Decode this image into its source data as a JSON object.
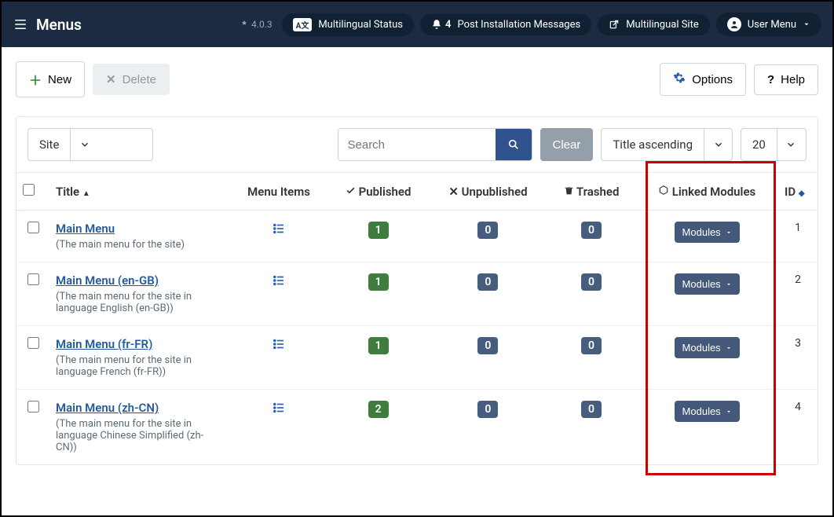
{
  "topnav": {
    "page_title": "Menus",
    "version": "4.0.3",
    "multilingual_status_label": "Multilingual Status",
    "post_install_count": "4",
    "post_install_label": "Post Installation Messages",
    "multilingual_site_label": "Multilingual Site",
    "user_menu_label": "User Menu"
  },
  "toolbar": {
    "new_label": "New",
    "delete_label": "Delete",
    "options_label": "Options",
    "help_label": "Help"
  },
  "filters": {
    "client_label": "Site",
    "search_placeholder": "Search",
    "clear_label": "Clear",
    "sort_label": "Title ascending",
    "limit_label": "20"
  },
  "columns": {
    "title": "Title",
    "menu_items": "Menu Items",
    "published": "Published",
    "unpublished": "Unpublished",
    "trashed": "Trashed",
    "linked_modules": "Linked Modules",
    "id": "ID"
  },
  "modules_btn_label": "Modules",
  "rows": [
    {
      "title": "Main Menu",
      "desc": "(The main menu for the site)",
      "published": "1",
      "unpublished": "0",
      "trashed": "0",
      "id": "1"
    },
    {
      "title": "Main Menu (en-GB)",
      "desc": "(The main menu for the site in language English (en-GB))",
      "published": "1",
      "unpublished": "0",
      "trashed": "0",
      "id": "2"
    },
    {
      "title": "Main Menu (fr-FR)",
      "desc": "(The main menu for the site in language French (fr-FR))",
      "published": "1",
      "unpublished": "0",
      "trashed": "0",
      "id": "3"
    },
    {
      "title": "Main Menu (zh-CN)",
      "desc": "(The main menu for the site in language Chinese Simplified (zh-CN))",
      "published": "2",
      "unpublished": "0",
      "trashed": "0",
      "id": "4"
    }
  ]
}
